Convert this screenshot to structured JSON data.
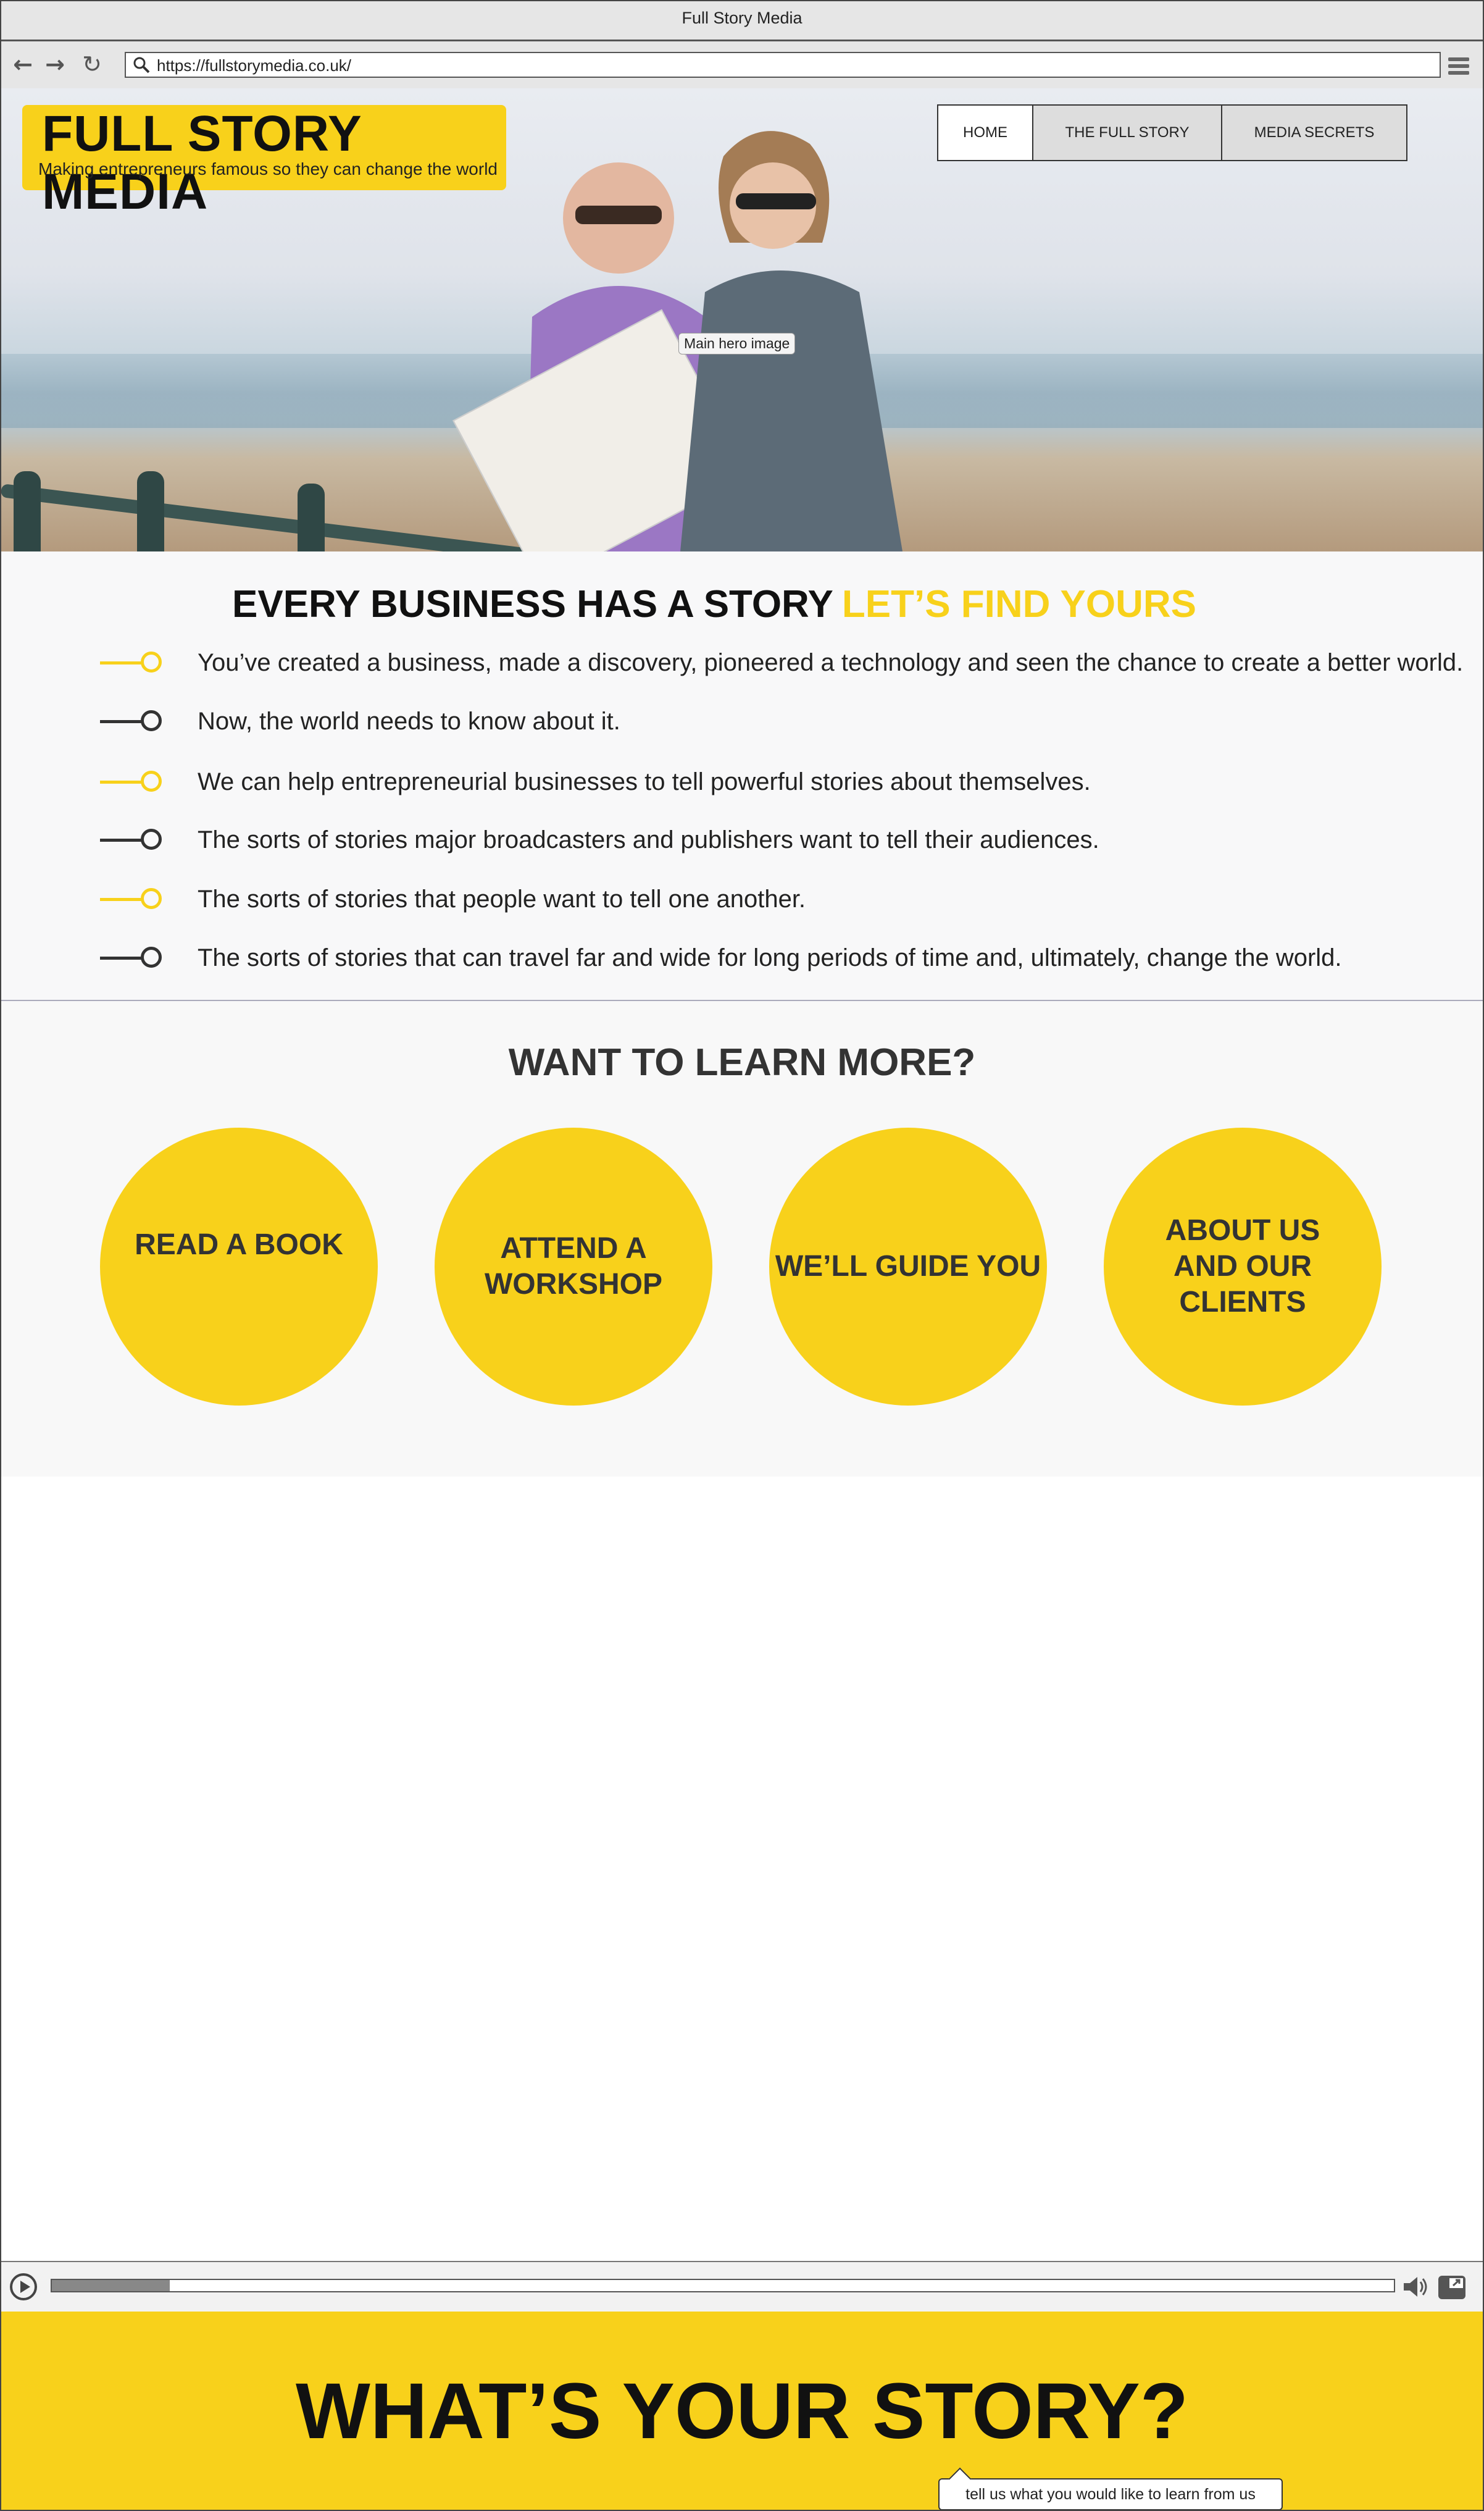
{
  "browser": {
    "window_title": "Full Story Media",
    "url": "https://fullstorymedia.co.uk/"
  },
  "brand": {
    "name": "FULL STORY MEDIA",
    "tagline": "Making entrepreneurs famous so they can change the world",
    "accent_color": "#f8d11b"
  },
  "nav": {
    "tabs": [
      {
        "label": "HOME",
        "active": true
      },
      {
        "label": "THE FULL STORY",
        "active": false
      },
      {
        "label": "MEDIA SECRETS",
        "active": false
      }
    ]
  },
  "hero": {
    "image_label": "Main hero image"
  },
  "story": {
    "heading": "EVERY BUSINESS HAS A STORY",
    "heading_accent": "LET’S FIND YOURS",
    "bullets": [
      "You’ve created a business, made a discovery, pioneered a technology and seen the chance to create a better world.",
      "Now, the world needs to know about it.",
      "We can help entrepreneurial businesses to tell powerful stories about themselves.",
      "The sorts of stories major broadcasters and publishers want to tell their audiences.",
      "The sorts of stories that people want to tell one another.",
      "The sorts of stories that can travel far and wide for long periods of time and, ultimately, change the world."
    ]
  },
  "learn": {
    "heading": "WANT TO LEARN MORE?",
    "buttons": [
      "READ A BOOK",
      "ATTEND A WORKSHOP",
      "WE’LL GUIDE YOU",
      "ABOUT US AND OUR CLIENTS"
    ]
  },
  "video": {
    "progress": 0.088
  },
  "cta": {
    "heading": "WHAT’S YOUR STORY?",
    "tooltip": "tell us what you would like to learn from us"
  }
}
